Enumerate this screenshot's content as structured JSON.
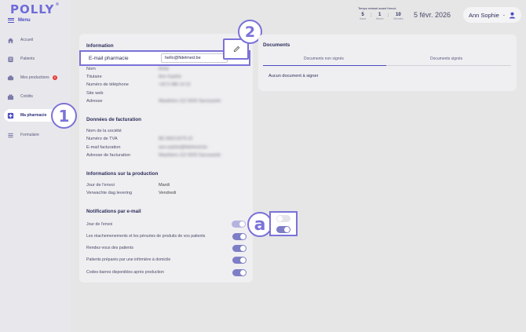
{
  "app": {
    "logo": "POLLY",
    "logo_mark": "®"
  },
  "sidebar": {
    "menu_label": "Menu",
    "items": [
      {
        "label": "Accueil",
        "icon": "home-icon"
      },
      {
        "label": "Patients",
        "icon": "patients-icon"
      },
      {
        "label": "Mes productions",
        "icon": "production-icon",
        "badge": "3"
      },
      {
        "label": "Crédits",
        "icon": "credits-icon"
      },
      {
        "label": "Ma pharmacie",
        "icon": "pharmacy-icon",
        "active": true
      },
      {
        "label": "Formulaire",
        "icon": "form-icon"
      }
    ]
  },
  "header": {
    "timer_title": "Temps restant avant l'envoi",
    "timer": [
      {
        "value": "5",
        "unit": "Jours"
      },
      {
        "value": "1",
        "unit": "Heure"
      },
      {
        "value": "10",
        "unit": "Minutes"
      }
    ],
    "date": "5 févr. 2026",
    "user_name": "Ann Sophie"
  },
  "information": {
    "title": "Information",
    "email_label": "E-mail pharmacie",
    "email_value": "hello@fidelmed.be",
    "rows": [
      {
        "label": "Nom",
        "value": "Antal"
      },
      {
        "label": "Titulaire",
        "value": "Ann Sophie"
      },
      {
        "label": "Numéro de téléphone",
        "value": "+32 0 486 14 12"
      },
      {
        "label": "Site web",
        "value": ""
      },
      {
        "label": "Adresse",
        "value": "Wauthiers 112 3020 Sacrasante"
      }
    ]
  },
  "billing": {
    "title": "Données de facturation",
    "rows": [
      {
        "label": "Nom de la société",
        "value": ""
      },
      {
        "label": "Numéro de TVA",
        "value": "BE 0602.6275.15"
      },
      {
        "label": "E-mail facturation",
        "value": "ann.sophie@fidelmed.be"
      },
      {
        "label": "Adresse de facturation",
        "value": "Wauthiers 112 3020 Sacrasante"
      }
    ]
  },
  "production": {
    "title": "Informations sur la production",
    "rows": [
      {
        "label": "Jour de l'envoi",
        "value": "Mardi"
      },
      {
        "label": "Verwachte dag levering",
        "value": "Vendredi"
      }
    ]
  },
  "notifications": {
    "title": "Notifications par e-mail",
    "rows": [
      {
        "label": "Jour de l'envoi",
        "state": "on"
      },
      {
        "label": "Les réachemenements et les pénuries de produits de vos patients",
        "state": "on"
      },
      {
        "label": "Rendez-vous des patients",
        "state": "on"
      },
      {
        "label": "Patients préparés par une infirmière à domicile",
        "state": "on"
      },
      {
        "label": "Codes-barres disponibles après production",
        "state": "on"
      }
    ]
  },
  "documents": {
    "title": "Documents",
    "tabs": [
      {
        "label": "Documents non signés",
        "active": true
      },
      {
        "label": "Documents signés",
        "active": false
      }
    ],
    "empty_text": "Aucun document à signer"
  },
  "callouts": [
    "1",
    "2",
    "a"
  ],
  "colors": {
    "accent": "#7b72d8",
    "brand": "#6f6cd9",
    "toggle_on": "#7e7ec6"
  }
}
